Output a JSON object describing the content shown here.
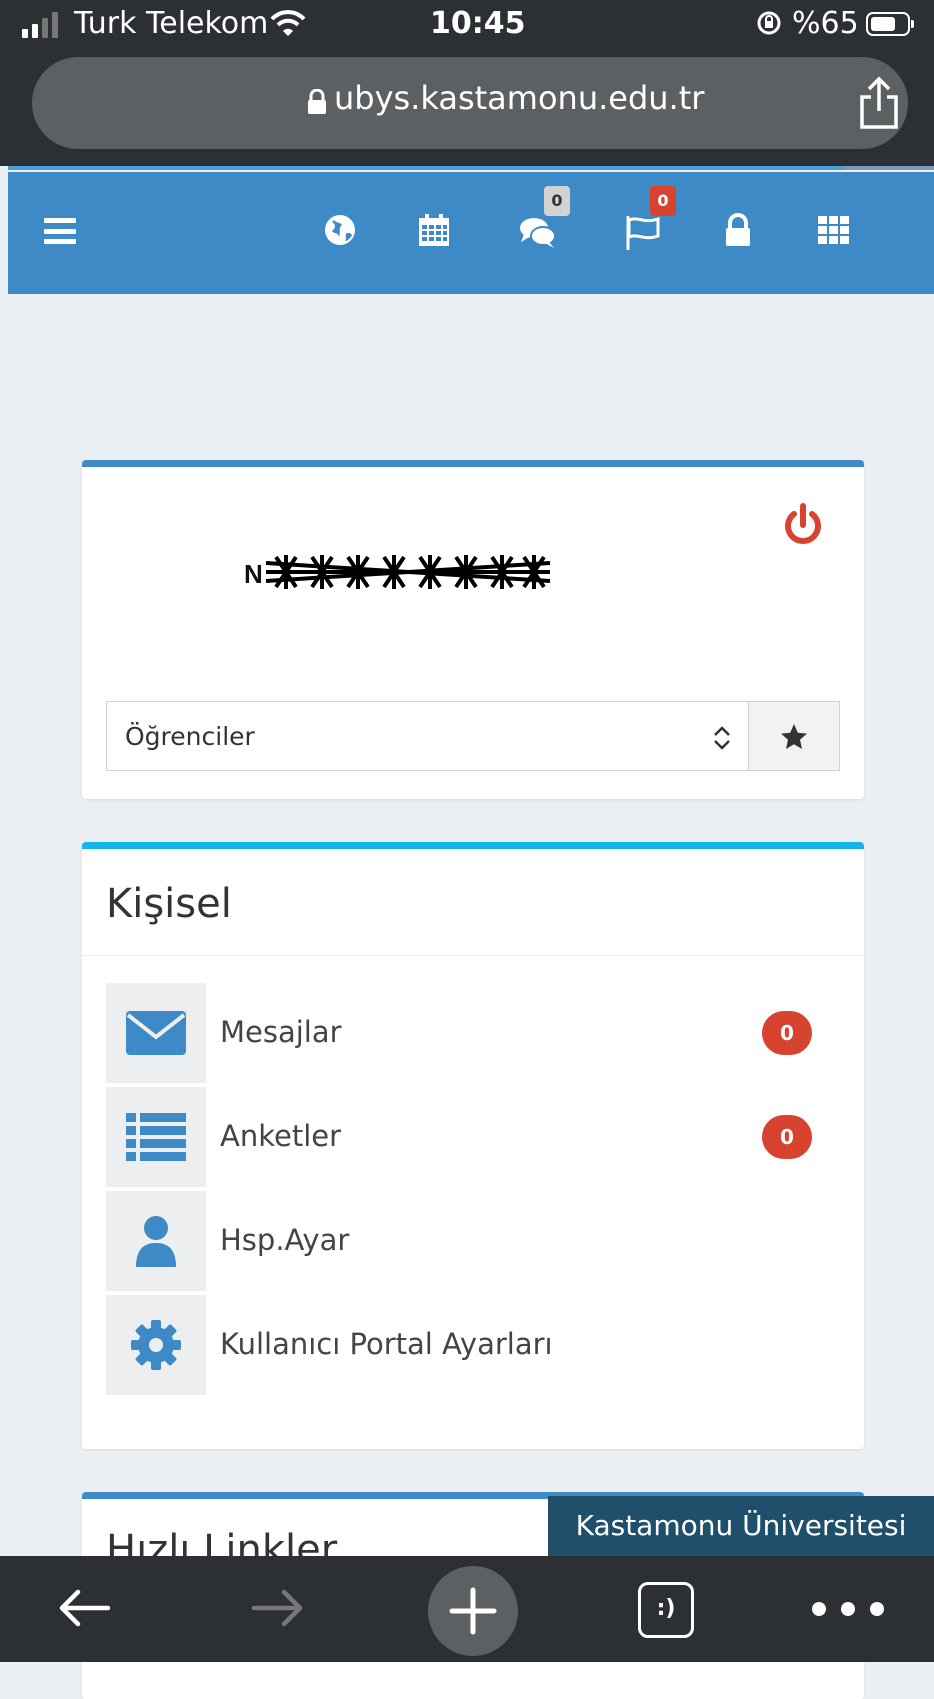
{
  "status_bar": {
    "carrier": "Turk Telekom",
    "time": "10:45",
    "battery": "%65"
  },
  "browser": {
    "url": "ubys.kastamonu.edu.tr",
    "tabs_label": ":)"
  },
  "header": {
    "messages_count": "0",
    "notifications_count": "0"
  },
  "profile": {
    "name_initial": "N",
    "role_select_value": "Öğrenciler"
  },
  "personal": {
    "title": "Kişisel",
    "items": [
      {
        "label": "Mesajlar",
        "count": "0",
        "icon": "envelope-icon"
      },
      {
        "label": "Anketler",
        "count": "0",
        "icon": "list-icon"
      },
      {
        "label": "Hsp.Ayar",
        "icon": "user-icon"
      },
      {
        "label": "Kullanıcı Portal Ayarları",
        "icon": "gear-icon"
      }
    ]
  },
  "quick_links": {
    "title": "Hızlı Linkler"
  },
  "banner": {
    "text": "Kastamonu Üniversitesi"
  },
  "colors": {
    "header_blue": "#3d8ac7",
    "accent_cyan": "#14b6e6",
    "badge_red": "#d6432f",
    "power_red": "#d6432f"
  }
}
